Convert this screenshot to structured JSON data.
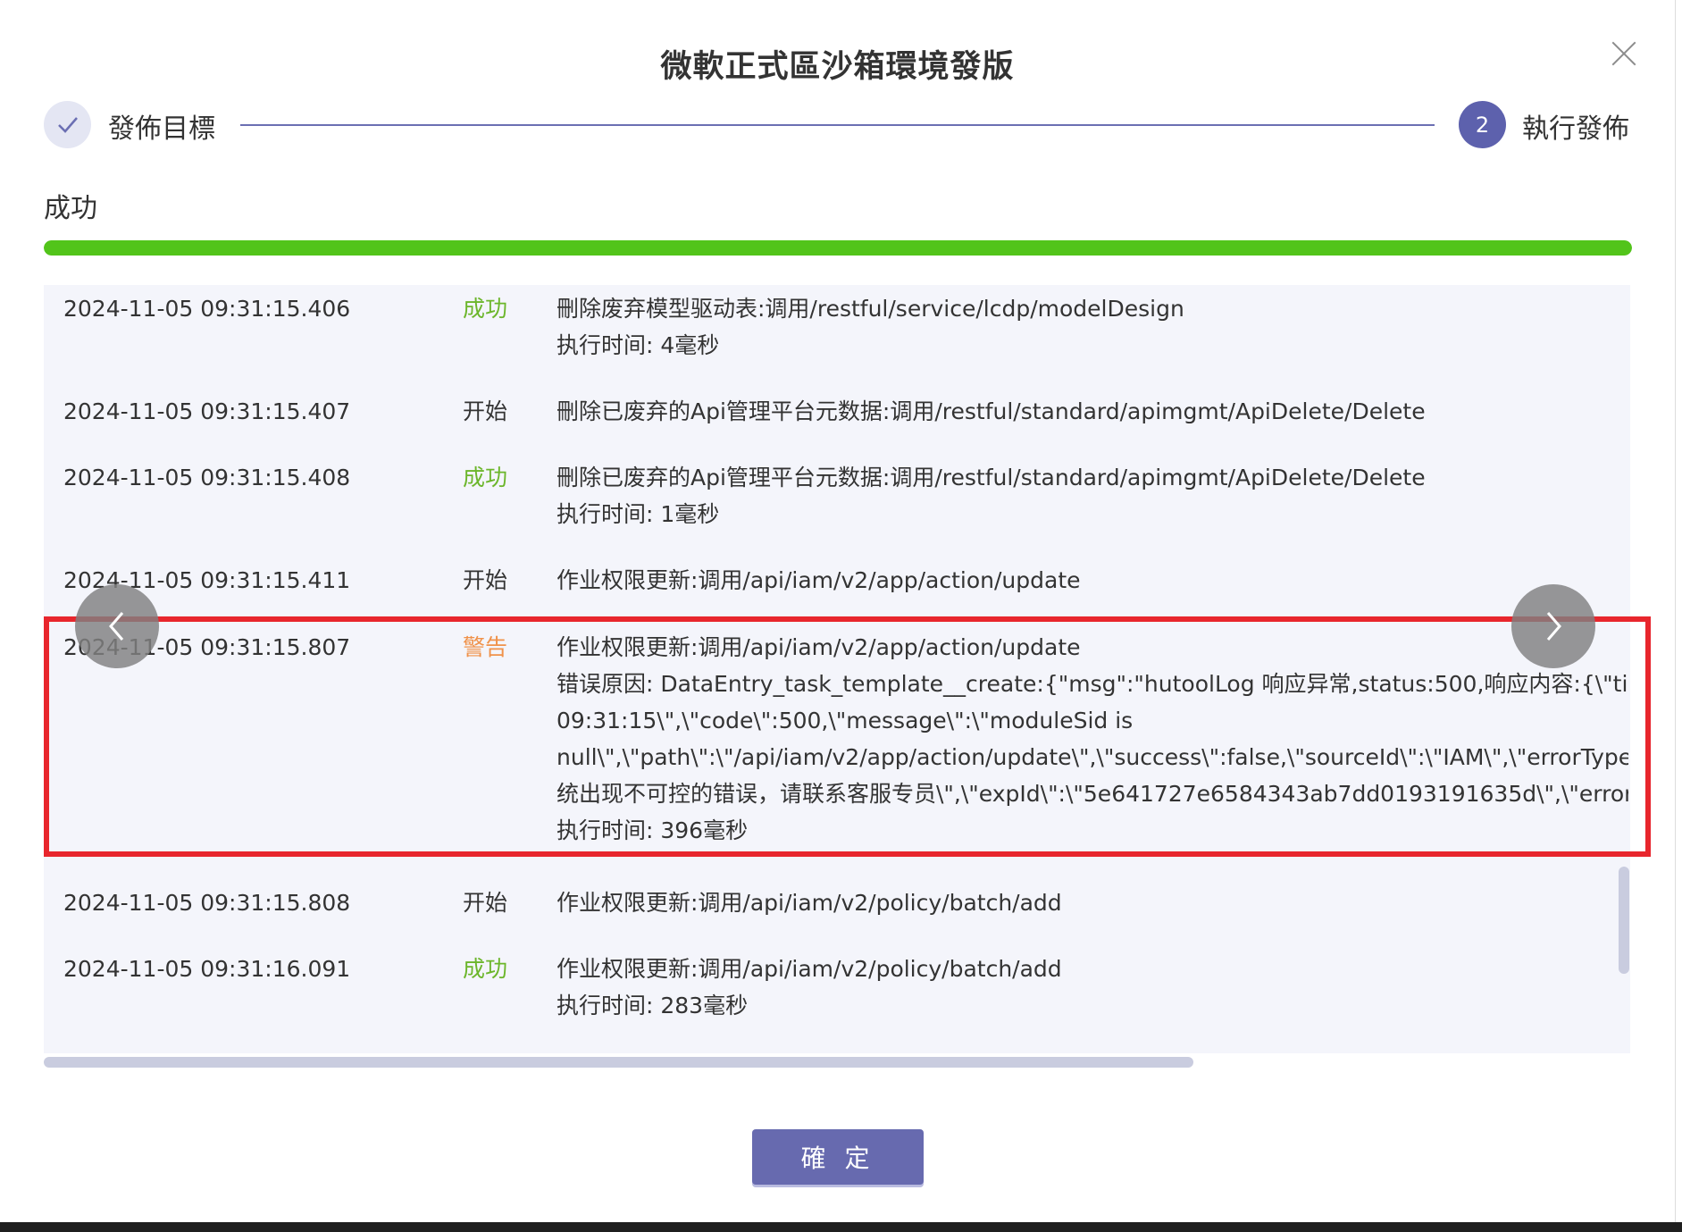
{
  "dialog": {
    "title": "微軟正式區沙箱環境發版"
  },
  "steps": [
    {
      "label": "發佈目標",
      "state": "done",
      "icon": "check-icon"
    },
    {
      "label": "執行發佈",
      "number": "2",
      "state": "active"
    }
  ],
  "status": {
    "text": "成功",
    "progress": 1.0,
    "progress_color": "#52c41a"
  },
  "logs": [
    {
      "time": "2024-11-05 09:31:15.406",
      "status": "成功",
      "status_type": "success",
      "lines": [
        "刪除废弃模型驱动表:调用/restful/service/lcdp/modelDesign",
        "执行时间: 4毫秒"
      ]
    },
    {
      "time": "2024-11-05 09:31:15.407",
      "status": "开始",
      "status_type": "start",
      "lines": [
        "刪除已废弃的Api管理平台元数据:调用/restful/standard/apimgmt/ApiDelete/Delete"
      ]
    },
    {
      "time": "2024-11-05 09:31:15.408",
      "status": "成功",
      "status_type": "success",
      "lines": [
        "刪除已废弃的Api管理平台元数据:调用/restful/standard/apimgmt/ApiDelete/Delete",
        "执行时间: 1毫秒"
      ]
    },
    {
      "time": "2024-11-05 09:31:15.411",
      "status": "开始",
      "status_type": "start",
      "lines": [
        "作业权限更新:调用/api/iam/v2/app/action/update"
      ]
    },
    {
      "time": "2024-11-05 09:31:15.807",
      "status": "警告",
      "status_type": "warning",
      "lines": [
        "作业权限更新:调用/api/iam/v2/app/action/update",
        "错误原因: DataEntry_task_template__create:{\"msg\":\"hutoolLog 响应异常,status:500,响应内容:{\\\"timestam",
        "09:31:15\\\",\\\"code\\\":500,\\\"message\\\":\\\"moduleSid is",
        "null\\\",\\\"path\\\":\\\"/api/iam/v2/app/action/update\\\",\\\"success\\\":false,\\\"sourceId\\\":\\\"IAM\\\",\\\"errorType\\\":\\\"U",
        "统出现不可控的错误，请联系客服专员\\\",\\\"expId\\\":\\\"5e641727e6584343ab7dd0193191635d\\\",\\\"errorIns",
        "执行时间: 396毫秒"
      ]
    },
    {
      "time": "2024-11-05 09:31:15.808",
      "status": "开始",
      "status_type": "start",
      "lines": [
        "作业权限更新:调用/api/iam/v2/policy/batch/add"
      ]
    },
    {
      "time": "2024-11-05 09:31:16.091",
      "status": "成功",
      "status_type": "success",
      "lines": [
        "作业权限更新:调用/api/iam/v2/policy/batch/add",
        "执行时间: 283毫秒"
      ]
    }
  ],
  "buttons": {
    "ok_label": "確 定"
  },
  "colors": {
    "accent": "#5d61ad",
    "success": "#6cb62b",
    "warning": "#f0924a",
    "highlight": "#e8262d"
  },
  "icons": {
    "close": "close-icon",
    "prev": "chevron-left-icon",
    "next": "chevron-right-icon"
  }
}
